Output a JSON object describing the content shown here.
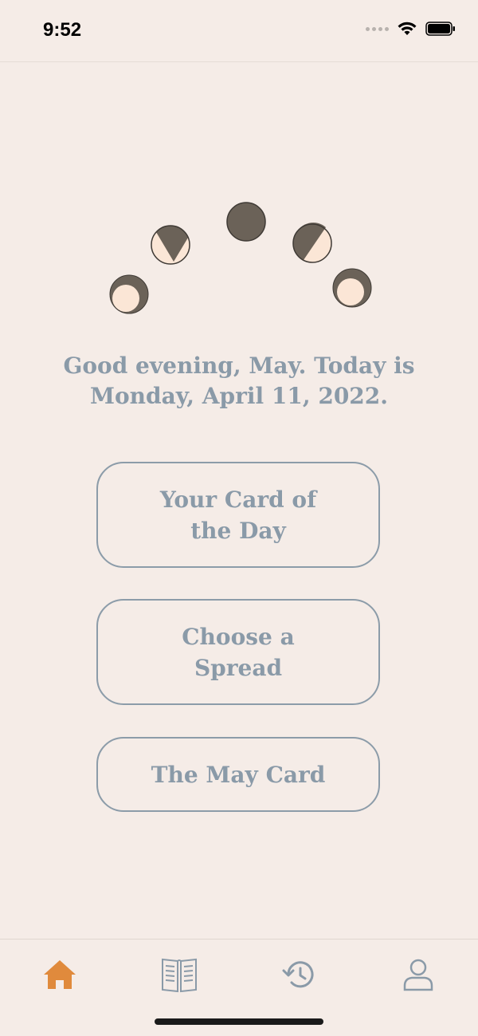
{
  "status": {
    "time": "9:52"
  },
  "greeting": {
    "line1": "Good evening, May. Today is",
    "line2": "Monday, April 11, 2022."
  },
  "buttons": {
    "card_of_day_line1": "Your Card of",
    "card_of_day_line2": "the Day",
    "spread_line1": "Choose a",
    "spread_line2": "Spread",
    "may_card": "The May Card"
  },
  "tabs": [
    {
      "icon": "home-icon",
      "active": true
    },
    {
      "icon": "book-icon",
      "active": false
    },
    {
      "icon": "history-icon",
      "active": false
    },
    {
      "icon": "profile-icon",
      "active": false
    }
  ],
  "colors": {
    "background": "#f5ece7",
    "text_accent": "#8a9aa8",
    "active_tab": "#e08a3c",
    "inactive_tab": "#8a9aa8",
    "moon_dark": "#6b6258",
    "moon_light": "#fbe6d6"
  }
}
